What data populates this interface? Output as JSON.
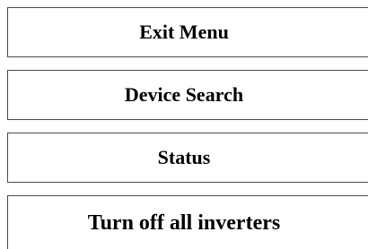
{
  "menu": {
    "items": [
      {
        "label": "Exit Menu"
      },
      {
        "label": "Device Search"
      },
      {
        "label": "Status"
      },
      {
        "label": "Turn off all inverters"
      }
    ]
  },
  "colors": {
    "border": "#4a4a4a",
    "background": "#ffffff",
    "text": "#000000"
  }
}
